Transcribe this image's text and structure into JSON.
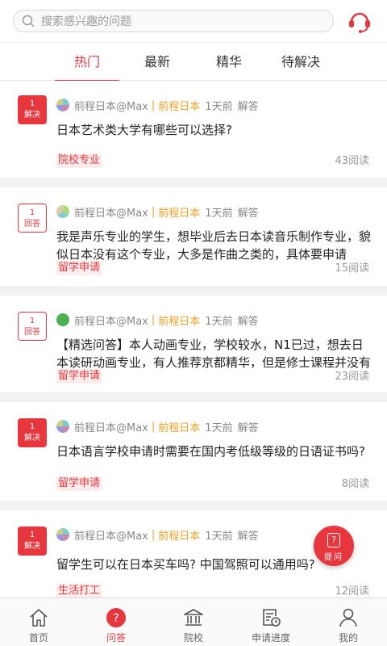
{
  "header": {
    "search_placeholder": "搜索感兴趣的问题",
    "service_icon": "customer-service-icon"
  },
  "tabs": [
    {
      "label": "热门",
      "active": true
    },
    {
      "label": "最新",
      "active": false
    },
    {
      "label": "精华",
      "active": false
    },
    {
      "label": "待解决",
      "active": false
    }
  ],
  "questions": [
    {
      "badge_num": "1",
      "badge_text": "解决",
      "badge_style": "solid",
      "author": "前程日本@Max",
      "school": "前程日本",
      "time": "1天前",
      "action": "解答",
      "text": "日本艺术类大学有哪些可以选择?",
      "tag": "院校专业",
      "reads": "43阅读"
    },
    {
      "badge_num": "1",
      "badge_text": "回答",
      "badge_style": "outline",
      "author": "前程日本@Max",
      "school": "前程日本",
      "time": "1天前",
      "action": "解答",
      "text": "我是声乐专业的学生，想毕业后去日本读音乐制作专业，貌似日本没有这个专业，大多是作曲之类的，具体要申请",
      "tag": "留学申请",
      "reads": "15阅读"
    },
    {
      "badge_num": "1",
      "badge_text": "回答",
      "badge_style": "outline",
      "author": "前程日本@Max",
      "school": "前程日本",
      "time": "1天前",
      "action": "解答",
      "text": "【精选问答】本人动画专业，学校较水，N1已过，想去日本读研动画专业，有人推荐京都精华，但是修士课程并没有",
      "tag": "留学申请",
      "reads": "23阅读"
    },
    {
      "badge_num": "1",
      "badge_text": "解决",
      "badge_style": "solid",
      "author": "前程日本@Max",
      "school": "前程日本",
      "time": "1天前",
      "action": "解答",
      "text": "日本语言学校申请时需要在国内考低级等级的日语证书吗?",
      "tag": "留学申请",
      "reads": "8阅读"
    },
    {
      "badge_num": "1",
      "badge_text": "解决",
      "badge_style": "solid",
      "author": "前程日本@Max",
      "school": "前程日本",
      "time": "1天前",
      "action": "解答",
      "text": "留学生可以在日本买车吗? 中国驾照可以通用吗?",
      "tag": "生活打工",
      "reads": "12阅读"
    }
  ],
  "fab": {
    "label": "提问"
  },
  "tabbar": [
    {
      "label": "首页",
      "icon": "home-icon",
      "active": false
    },
    {
      "label": "问答",
      "icon": "qa-icon",
      "active": true
    },
    {
      "label": "院校",
      "icon": "school-icon",
      "active": false
    },
    {
      "label": "申请进度",
      "icon": "progress-icon",
      "active": false
    },
    {
      "label": "我的",
      "icon": "profile-icon",
      "active": false
    }
  ],
  "colors": {
    "accent": "#e8363f",
    "school": "#f0a020"
  }
}
